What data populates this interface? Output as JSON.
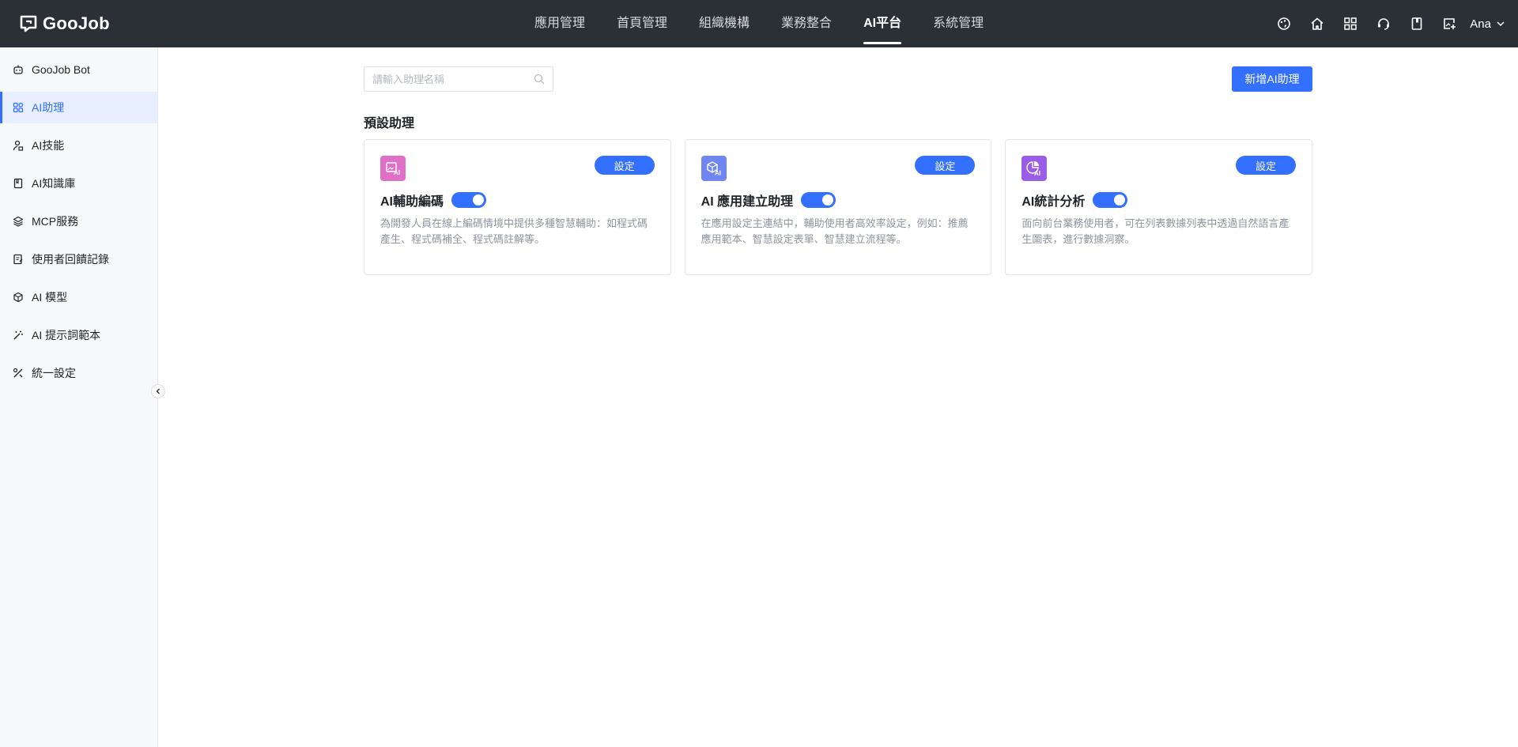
{
  "app": {
    "logo_text": "GooJob"
  },
  "nav": {
    "items": [
      {
        "label": "應用管理",
        "active": false
      },
      {
        "label": "首頁管理",
        "active": false
      },
      {
        "label": "組織機構",
        "active": false
      },
      {
        "label": "業務整合",
        "active": false
      },
      {
        "label": "AI平台",
        "active": true
      },
      {
        "label": "系統管理",
        "active": false
      }
    ]
  },
  "top_icons": [
    "palette-icon",
    "home-icon",
    "apps-grid-icon",
    "support-headset-icon",
    "book-icon",
    "image-edit-icon"
  ],
  "user": {
    "name": "Ana"
  },
  "sidebar": {
    "items": [
      {
        "label": "GooJob Bot",
        "icon": "bot-icon",
        "active": false
      },
      {
        "label": "AI助理",
        "icon": "grid-icon",
        "active": true
      },
      {
        "label": "AI技能",
        "icon": "skill-icon",
        "active": false
      },
      {
        "label": "AI知識庫",
        "icon": "book-icon",
        "active": false
      },
      {
        "label": "MCP服務",
        "icon": "layers-icon",
        "active": false
      },
      {
        "label": "使用者回饋記錄",
        "icon": "feedback-icon",
        "active": false
      },
      {
        "label": "AI 模型",
        "icon": "cube-icon",
        "active": false
      },
      {
        "label": "AI 提示詞範本",
        "icon": "magic-wand-icon",
        "active": false
      },
      {
        "label": "統一設定",
        "icon": "settings-tools-icon",
        "active": false
      }
    ]
  },
  "main": {
    "search": {
      "placeholder": "請輸入助理名稱",
      "value": ""
    },
    "add_button": "新增AI助理",
    "section_title": "預設助理",
    "cards": [
      {
        "name": "AI輔助編碼",
        "icon": "ai-image-icon",
        "icon_color": "#e06fc8",
        "settings_label": "設定",
        "enabled": true,
        "description": "為開發人員在線上編碼情境中提供多種智慧輔助：如程式碼產生、程式碼補全、程式碼註解等。"
      },
      {
        "name": "AI 應用建立助理",
        "icon": "ai-cube-icon",
        "icon_color": "#6f86f2",
        "settings_label": "設定",
        "enabled": true,
        "description": "在應用設定主連結中，輔助使用者高效率設定，例如：推薦應用範本、智慧設定表單、智慧建立流程等。"
      },
      {
        "name": "AI統計分析",
        "icon": "ai-chart-icon",
        "icon_color": "#9b5de5",
        "settings_label": "設定",
        "enabled": true,
        "description": "面向前台業務使用者，可在列表數據列表中透過自然語言產生圖表，進行數據洞察。"
      }
    ]
  },
  "colors": {
    "accent": "#3370ff",
    "topbar": "#2b2f36",
    "sidebar_bg": "#f7f8fa"
  }
}
